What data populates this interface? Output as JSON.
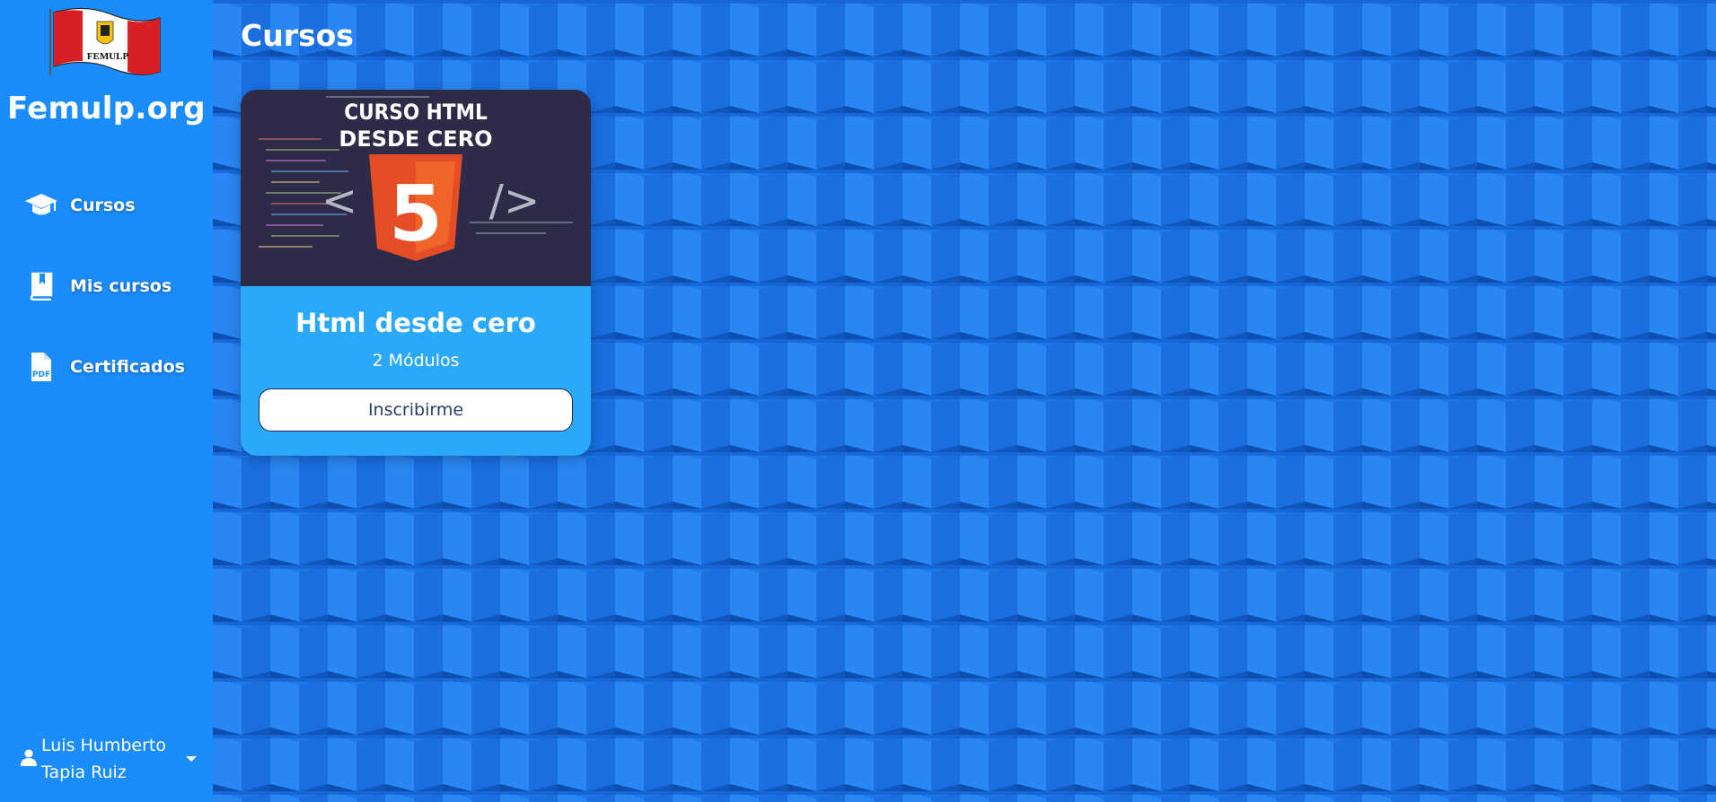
{
  "sidebar": {
    "logo_text": "FEMULP",
    "brand": "Femulp.org",
    "items": [
      {
        "label": "Cursos",
        "icon": "graduation-cap-icon"
      },
      {
        "label": "Mis cursos",
        "icon": "bookmark-book-icon"
      },
      {
        "label": "Certificados",
        "icon": "pdf-file-icon"
      }
    ],
    "user": {
      "name": "Luis Humberto Tapia Ruiz",
      "icon": "user-icon",
      "dropdown_icon": "caret-down-icon"
    }
  },
  "main": {
    "title": "Cursos",
    "courses": [
      {
        "image_line1": "CURSO HTML",
        "image_line2": "DESDE CERO",
        "image_glyph": "5",
        "image_left": "<",
        "image_right": "/>",
        "title": "Html desde cero",
        "modules": "2 Módulos",
        "button": "Inscribirme"
      }
    ]
  },
  "colors": {
    "sidebar": "#1a8cfb",
    "pattern": "#1a76e8",
    "card": "#2aa9fa",
    "html5_orange": "#e44d26"
  }
}
